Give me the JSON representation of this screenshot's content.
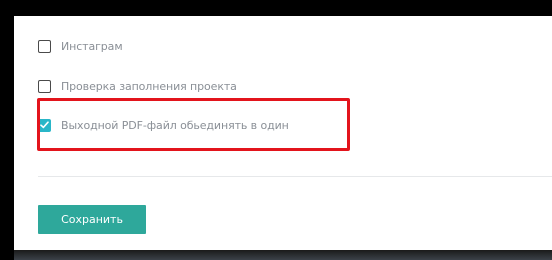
{
  "settings": {
    "options": [
      {
        "label": "Инстаграм",
        "checked": false
      },
      {
        "label": "Проверка заполнения проекта",
        "checked": false
      },
      {
        "label": "Выходной PDF-файл обьединять в один",
        "checked": true
      }
    ]
  },
  "actions": {
    "save_label": "Сохранить"
  },
  "colors": {
    "accent": "#2ea89b",
    "checkbox_checked": "#29b6c8",
    "highlight": "#e3141c",
    "label_text": "#8a8f96"
  },
  "icons": {
    "checked_mark": "check-icon"
  }
}
